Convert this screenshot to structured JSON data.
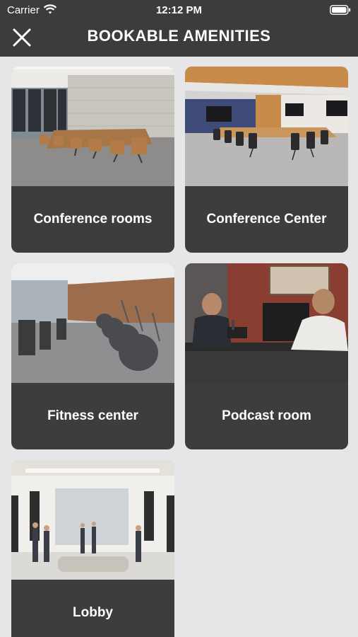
{
  "status_bar": {
    "carrier": "Carrier",
    "time": "12:12 PM",
    "wifi_icon": "wifi-icon",
    "battery_icon": "battery-icon"
  },
  "header": {
    "title": "BOOKABLE AMENITIES",
    "close_icon": "close-icon",
    "background": "#3c3c3c"
  },
  "amenities": [
    {
      "label": "Conference rooms",
      "image": "conference-room-photo"
    },
    {
      "label": "Conference Center",
      "image": "conference-center-photo"
    },
    {
      "label": "Fitness center",
      "image": "fitness-center-photo"
    },
    {
      "label": "Podcast room",
      "image": "podcast-room-photo"
    },
    {
      "label": "Lobby",
      "image": "lobby-photo"
    }
  ],
  "colors": {
    "page_background": "#e6e6e8",
    "card_label_background": "#3d3d3d",
    "text": "#ffffff"
  }
}
